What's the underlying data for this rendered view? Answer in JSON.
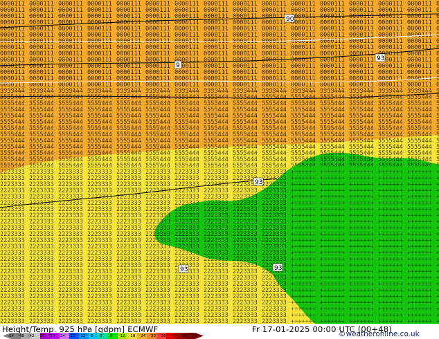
{
  "footer": {
    "title": "Height/Temp. 925 hPa [gdpm] ECMWF",
    "valid_time": "Fr 17-01-2025 00:00 UTC (00+48)",
    "credit": "©weatheronline.co.uk"
  },
  "colorbar": {
    "ticks": [
      "-54",
      "-48",
      "-42",
      "-38",
      "-30",
      "-24",
      "-18",
      "-12",
      "-8",
      "0",
      "8",
      "12",
      "18",
      "24",
      "30",
      "38",
      "42",
      "48",
      "54"
    ],
    "colors": [
      "#7f7f7f",
      "#a6a6a6",
      "#c8c8c8",
      "#a000c8",
      "#c000ff",
      "#d070ff",
      "#0050ff",
      "#0096ff",
      "#00c8ff",
      "#00dca0",
      "#00e600",
      "#a0e600",
      "#e6dc32",
      "#e6af2d",
      "#f08228",
      "#fa3c3c",
      "#e10000",
      "#a00000",
      "#780000"
    ]
  },
  "map": {
    "colors": {
      "warm_orange": "#f2a92c",
      "yellow": "#f7e43a",
      "green": "#16c40e",
      "contour_black": "#000000",
      "contour_white": "#ffffff"
    },
    "height_labels": [
      "90",
      "9",
      "93",
      "93",
      "93",
      "93"
    ]
  }
}
